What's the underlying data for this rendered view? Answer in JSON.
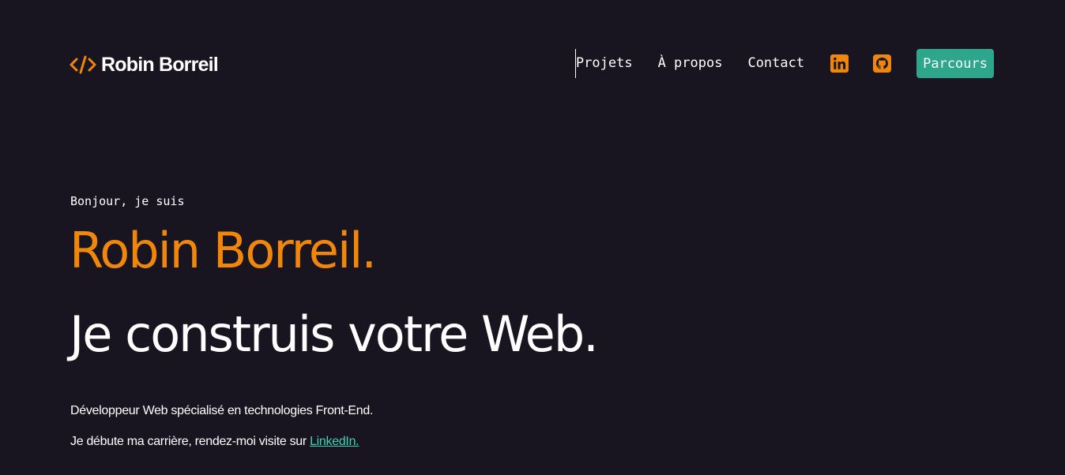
{
  "colors": {
    "background": "#181521",
    "accent_orange": "#f0870b",
    "accent_teal": "#2da68b",
    "link_teal": "#3fd0b4",
    "text": "#ffffff"
  },
  "header": {
    "logo": {
      "icon": "code-brackets-icon",
      "text": "Robin Borreil"
    },
    "nav": {
      "projects": "Projets",
      "about": "À propos",
      "contact": "Contact",
      "linkedin_icon": "linkedin-icon",
      "github_icon": "github-icon",
      "cta": "Parcours"
    }
  },
  "hero": {
    "greeting": "Bonjour, je suis",
    "name": "Robin Borreil.",
    "tagline": "Je construis votre Web.",
    "description_1": "Développeur Web spécialisé en technologies Front-End.",
    "description_2_prefix": "Je débute ma carrière, rendez-moi visite sur ",
    "description_2_link": "LinkedIn."
  }
}
